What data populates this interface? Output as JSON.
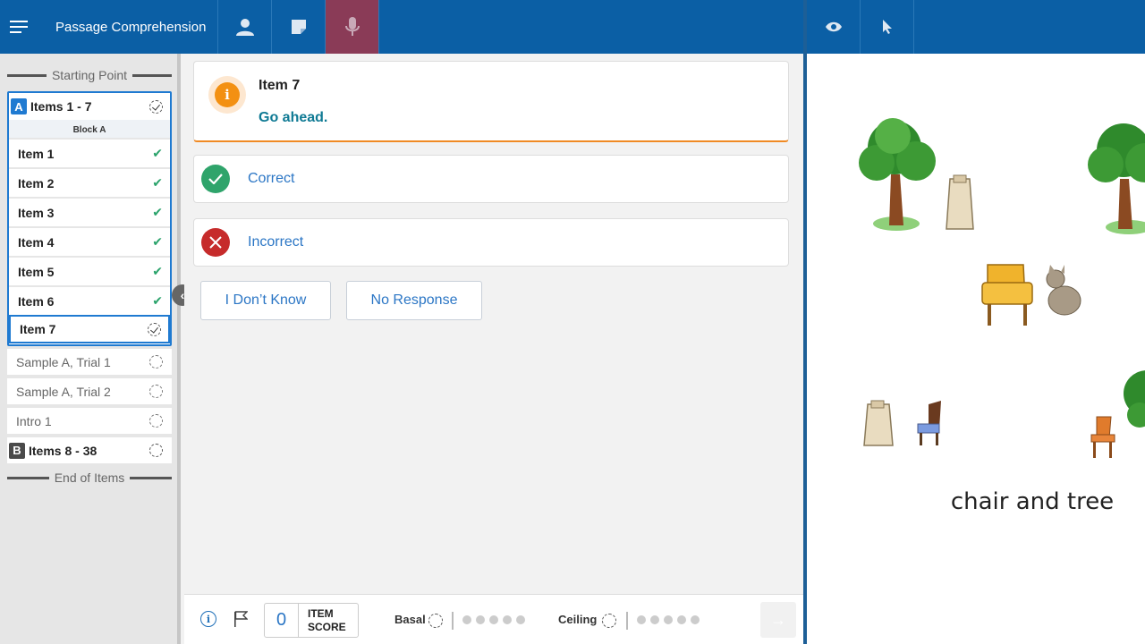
{
  "header": {
    "title": "Passage Comprehension",
    "icons": [
      "menu-icon",
      "person-icon",
      "note-icon",
      "microphone-icon"
    ],
    "right_icons": [
      "eye-icon",
      "pointer-icon"
    ]
  },
  "sidebar": {
    "starting_point": "Starting Point",
    "end_of_items": "End of Items",
    "blockA": {
      "letter": "A",
      "title": "Items 1 - 7",
      "subtitle": "Block A",
      "items": [
        {
          "label": "Item 1",
          "status": "correct"
        },
        {
          "label": "Item 2",
          "status": "correct"
        },
        {
          "label": "Item 3",
          "status": "correct"
        },
        {
          "label": "Item 4",
          "status": "correct"
        },
        {
          "label": "Item 5",
          "status": "correct"
        },
        {
          "label": "Item 6",
          "status": "correct"
        },
        {
          "label": "Item 7",
          "status": "current"
        }
      ]
    },
    "extra_items": [
      "Sample A, Trial 1",
      "Sample A, Trial 2",
      "Intro 1"
    ],
    "blockB": {
      "letter": "B",
      "title": "Items 8 - 38"
    }
  },
  "main": {
    "info_card": {
      "title": "Item 7",
      "message": "Go ahead."
    },
    "responses": {
      "correct": "Correct",
      "incorrect": "Incorrect"
    },
    "buttons": {
      "dont_know": "I Don’t Know",
      "no_response": "No Response"
    }
  },
  "bottom": {
    "item_score": "0",
    "item_score_label_1": "ITEM",
    "item_score_label_2": "SCORE",
    "basal": "Basal",
    "ceiling": "Ceiling"
  },
  "stimulus": {
    "caption": "chair and tree"
  },
  "colors": {
    "header_blue": "#0b5fa5",
    "mic_active": "#8a3b57",
    "accent_blue": "#1f7ad1",
    "correct_green": "#2fa46b",
    "incorrect_red": "#c62b2b",
    "info_orange": "#f39012"
  }
}
